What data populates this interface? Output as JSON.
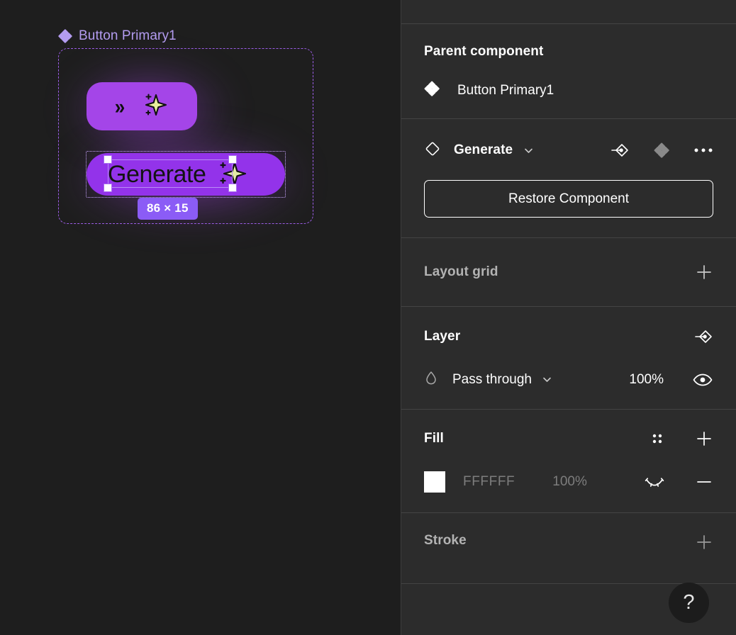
{
  "canvas": {
    "frame_label": "Button Primary1",
    "frame_label_icon": "component-diamond-icon",
    "button_top": {
      "chevron_icon": "double-chevron-right-icon",
      "chevron_glyph": "»",
      "sparkle_icon": "sparkle-icon"
    },
    "button_selected": {
      "text": "Generate",
      "sparkle_icon": "sparkle-icon"
    },
    "size_badge": "86 × 15",
    "colors": {
      "canvas_background": "#1e1e1e",
      "frame_stroke": "#9b5de5",
      "frame_label_text": "#b39cf0",
      "button_top_fill": "#a445e8",
      "button_selected_fill": "#9333ea",
      "badge_fill": "#8b5cf6",
      "sparkle_fill": "#e9ef9c",
      "handle_fill": "#ffffff"
    }
  },
  "panel": {
    "parent_component": {
      "title": "Parent component",
      "icon": "component-diamond-icon",
      "name": "Button Primary1"
    },
    "generate": {
      "icon": "diamond-outline-icon",
      "name": "Generate",
      "caret_icon": "chevron-down-icon",
      "swap_instance_icon": "swap-instance-icon",
      "main_component_icon": "component-diamond-icon",
      "more_icon": "more-horizontal-icon",
      "restore_label": "Restore Component"
    },
    "layout_grid": {
      "title": "Layout grid",
      "add_icon": "plus-icon"
    },
    "layer": {
      "title": "Layer",
      "apply_icon": "swap-instance-icon",
      "blend_icon": "blend-mode-droplet-icon",
      "blend_mode": "Pass through",
      "caret_icon": "chevron-down-icon",
      "opacity": "100%",
      "visibility_icon": "eye-icon"
    },
    "fill": {
      "title": "Fill",
      "styles_icon": "style-grid-icon",
      "add_icon": "plus-icon",
      "swatch_color": "#FFFFFF",
      "hex": "FFFFFF",
      "opacity": "100%",
      "visibility_icon": "eye-closed-icon",
      "remove_icon": "minus-icon"
    },
    "stroke": {
      "title": "Stroke",
      "add_icon": "plus-icon"
    },
    "help": {
      "label": "?"
    },
    "colors": {
      "panel_background": "#2c2c2c",
      "divider": "#444444",
      "text_primary": "#ffffff",
      "text_dim": "#b3b3b3",
      "text_muted": "#7d7d7d"
    }
  }
}
